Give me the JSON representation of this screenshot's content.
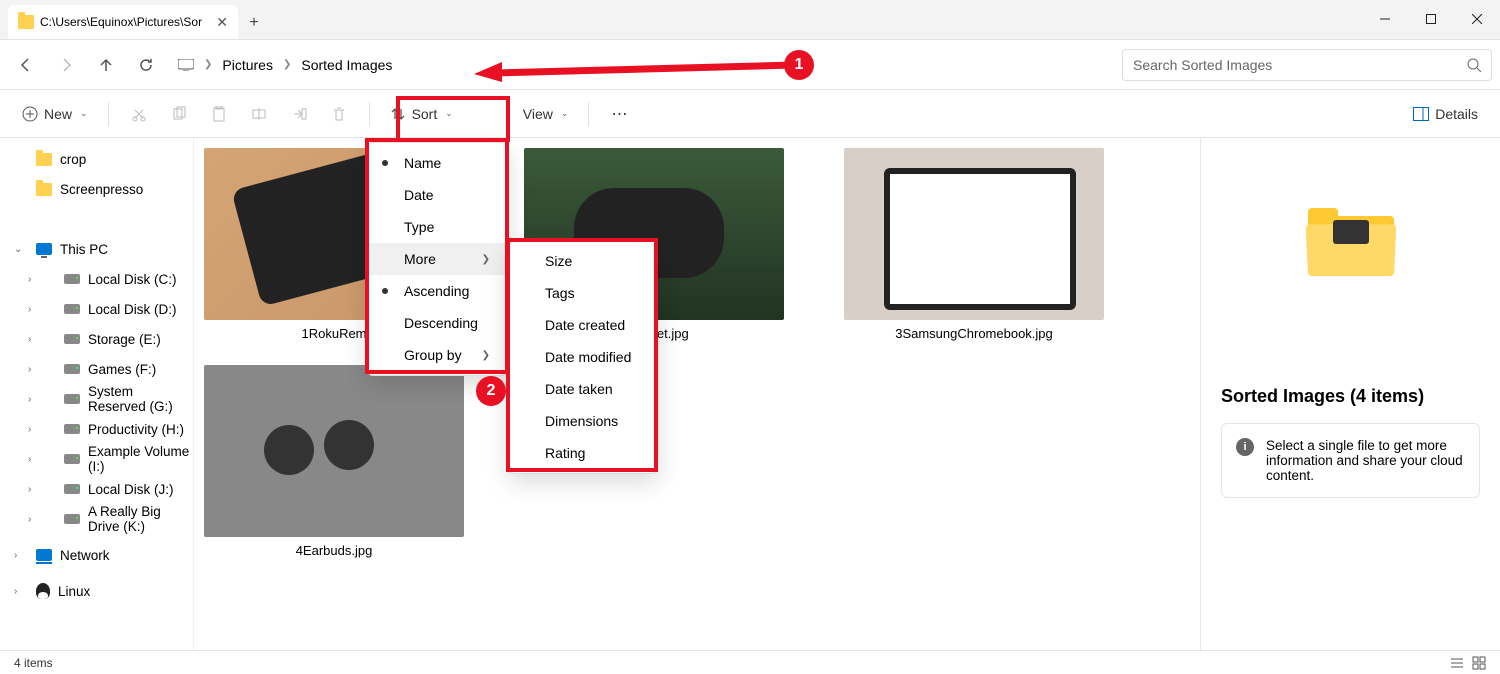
{
  "titlebar": {
    "tab_title": "C:\\Users\\Equinox\\Pictures\\Sor"
  },
  "breadcrumb": {
    "items": [
      "Pictures",
      "Sorted Images"
    ]
  },
  "search": {
    "placeholder": "Search Sorted Images"
  },
  "toolbar": {
    "new_label": "New",
    "sort_label": "Sort",
    "view_label": "View",
    "details_label": "Details"
  },
  "sidebar": {
    "top_folders": [
      "crop",
      "Screenpresso"
    ],
    "this_pc_label": "This PC",
    "drives": [
      "Local Disk (C:)",
      "Local Disk (D:)",
      "Storage (E:)",
      "Games (F:)",
      "System Reserved (G:)",
      "Productivity (H:)",
      "Example Volume (I:)",
      "Local Disk (J:)",
      "A Really Big Drive (K:)"
    ],
    "network_label": "Network",
    "linux_label": "Linux"
  },
  "files": [
    {
      "name": "1RokuRem",
      "thumb": "roku"
    },
    {
      "name": "Headset.jpg",
      "thumb": "vr"
    },
    {
      "name": "3SamsungChromebook.jpg",
      "thumb": "chrome"
    },
    {
      "name": "4Earbuds.jpg",
      "thumb": "ear"
    }
  ],
  "sort_menu": {
    "items": [
      "Name",
      "Date",
      "Type",
      "More",
      "Ascending",
      "Descending",
      "Group by"
    ],
    "selected": "Name",
    "hover": "More"
  },
  "more_menu": {
    "items": [
      "Size",
      "Tags",
      "Date created",
      "Date modified",
      "Date taken",
      "Dimensions",
      "Rating"
    ]
  },
  "details": {
    "title": "Sorted Images (4 items)",
    "hint": "Select a single file to get more information and share your cloud content."
  },
  "statusbar": {
    "text": "4 items"
  },
  "annotations": {
    "badge1": "1",
    "badge2": "2"
  }
}
